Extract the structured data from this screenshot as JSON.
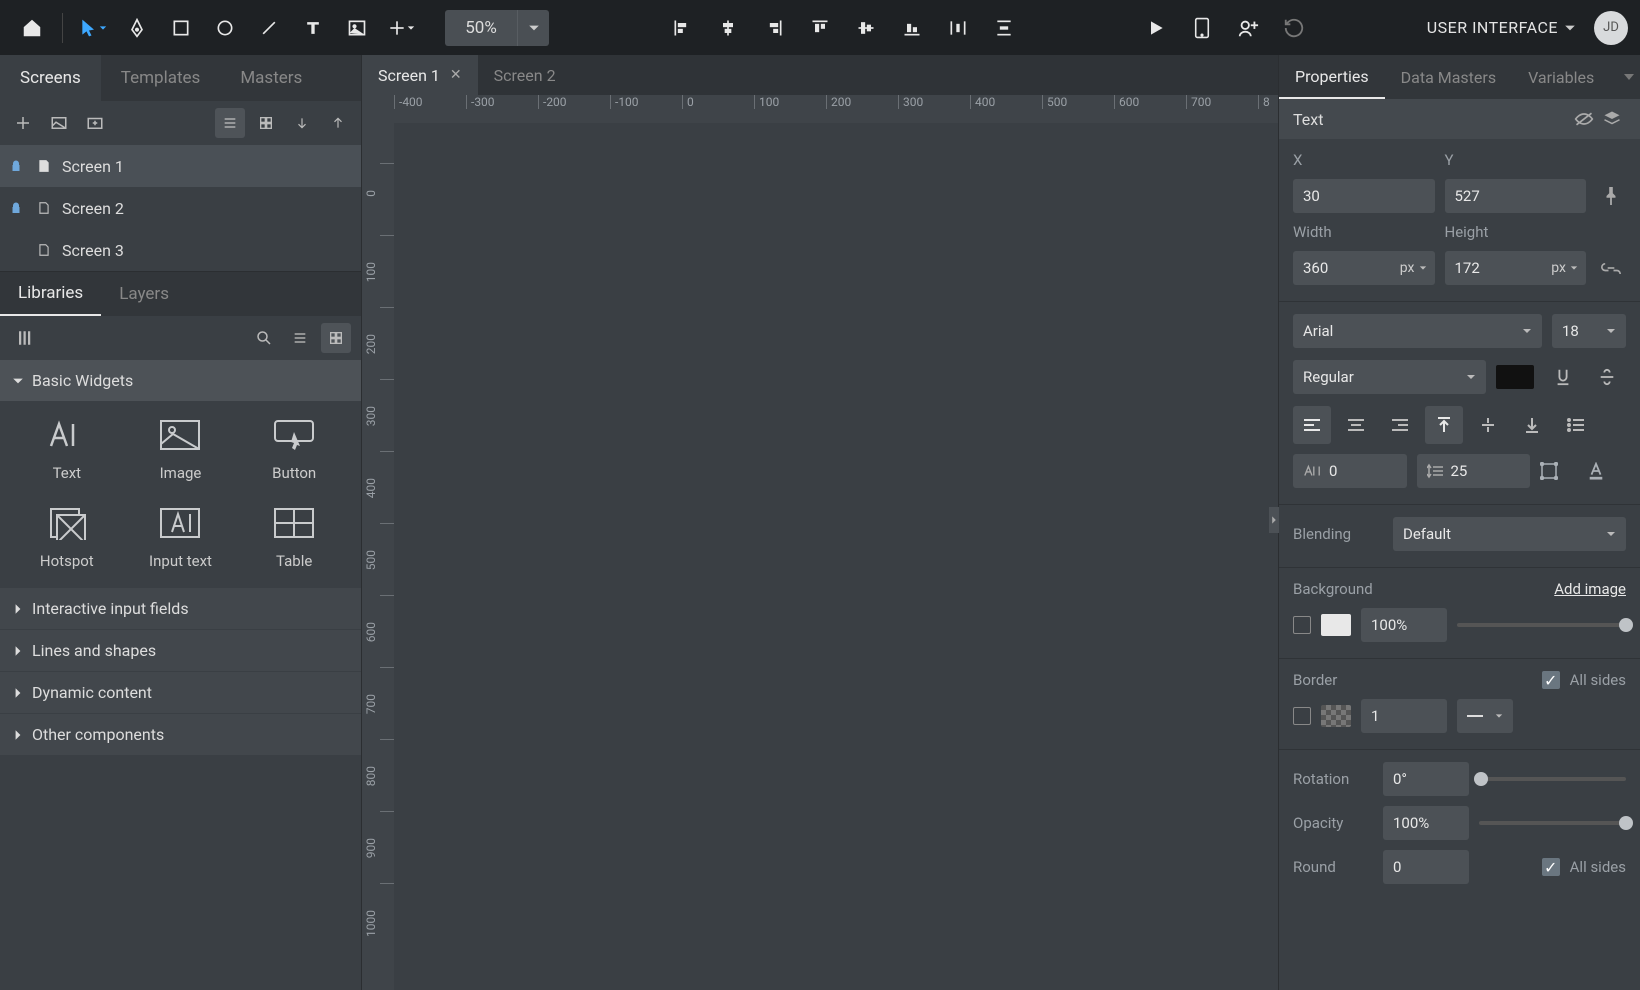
{
  "topbar": {
    "zoom": "50%",
    "project_name": "USER INTERFACE",
    "avatar_initials": "JD"
  },
  "left_tabs": [
    "Screens",
    "Templates",
    "Masters"
  ],
  "screens": [
    {
      "name": "Screen 1",
      "locked": true,
      "home": true,
      "selected": true
    },
    {
      "name": "Screen 2",
      "locked": true,
      "home": false,
      "selected": false
    },
    {
      "name": "Screen 3",
      "locked": false,
      "home": false,
      "selected": false
    }
  ],
  "lib_tabs": [
    "Libraries",
    "Layers"
  ],
  "lib_categories": [
    {
      "name": "Basic Widgets",
      "open": true
    },
    {
      "name": "Interactive input fields",
      "open": false
    },
    {
      "name": "Lines and shapes",
      "open": false
    },
    {
      "name": "Dynamic content",
      "open": false
    },
    {
      "name": "Other components",
      "open": false
    }
  ],
  "widgets": [
    "Text",
    "Image",
    "Button",
    "Hotspot",
    "Input text",
    "Table"
  ],
  "canvas_tabs": [
    {
      "name": "Screen 1",
      "active": true
    },
    {
      "name": "Screen 2",
      "active": false
    }
  ],
  "ruler_h": [
    "-400",
    "-300",
    "-200",
    "-100",
    "0",
    "100",
    "200",
    "300",
    "400",
    "500",
    "600",
    "700",
    "8"
  ],
  "ruler_v": [
    "0",
    "100",
    "200",
    "300",
    "400",
    "500",
    "600",
    "700",
    "800",
    "900",
    "1000"
  ],
  "right_tabs": [
    "Properties",
    "Data Masters",
    "Variables"
  ],
  "inspector": {
    "element_type": "Text",
    "x_label": "X",
    "x": "30",
    "y_label": "Y",
    "y": "527",
    "w_label": "Width",
    "w": "360",
    "w_unit": "px",
    "h_label": "Height",
    "h": "172",
    "h_unit": "px",
    "font_family": "Arial",
    "font_size": "18",
    "font_weight": "Regular",
    "letter_spacing": "0",
    "line_height": "25",
    "blending_label": "Blending",
    "blending": "Default",
    "background_label": "Background",
    "add_image": "Add image",
    "bg_opacity": "100%",
    "border_label": "Border",
    "all_sides": "All sides",
    "border_width": "1",
    "rotation_label": "Rotation",
    "rotation": "0°",
    "opacity_label": "Opacity",
    "opacity": "100%",
    "round_label": "Round",
    "round": "0"
  }
}
